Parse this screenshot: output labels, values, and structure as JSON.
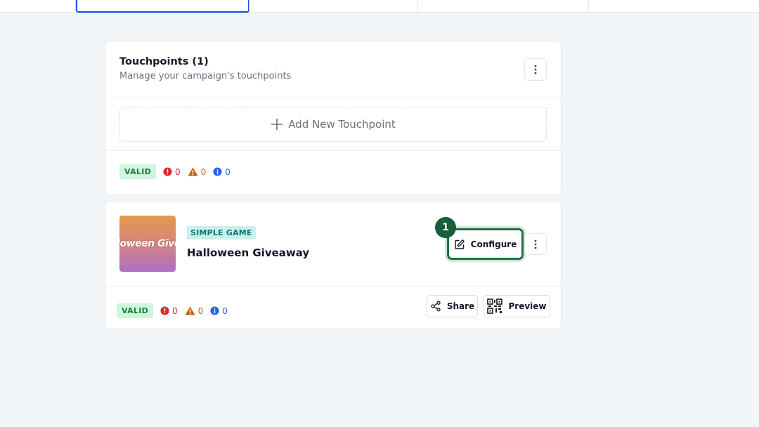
{
  "touchpoints_section": {
    "title": "Touchpoints (1)",
    "subtitle": "Manage your campaign's touchpoints",
    "add_label": "Add New Touchpoint",
    "status": {
      "badge": "VALID",
      "errors": "0",
      "warnings": "0",
      "infos": "0"
    }
  },
  "touchpoint": {
    "thumbnail_text": "lloween Givea",
    "type_badge": "SIMPLE GAME",
    "name": "Halloween Giveaway",
    "step_number": "1",
    "configure_label": "Configure",
    "share_label": "Share",
    "preview_label": "Preview",
    "status": {
      "badge": "VALID",
      "errors": "0",
      "warnings": "0",
      "infos": "0"
    }
  },
  "colors": {
    "valid_bg": "#d1f4dd",
    "valid_text": "#15803d",
    "error": "#dc2626",
    "warning": "#c2620a",
    "info": "#2563eb",
    "highlight_green": "#1f6f43"
  },
  "icons": {
    "kebab": "more-vertical-icon",
    "plus": "plus-icon",
    "error": "error-circle-icon",
    "warning": "warning-triangle-icon",
    "info": "info-circle-icon",
    "edit": "edit-pencil-icon",
    "share": "share-icon",
    "qr": "qr-code-icon"
  }
}
